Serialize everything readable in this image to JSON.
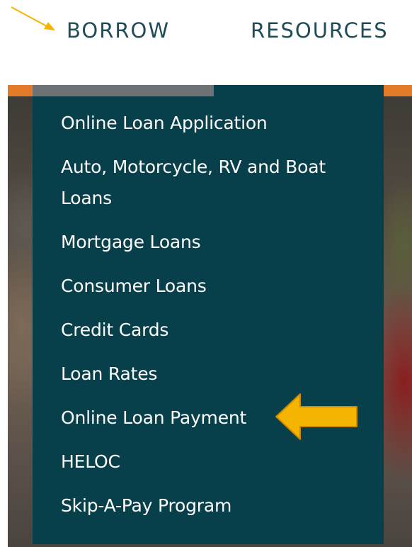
{
  "nav": {
    "borrow": "BORROW",
    "resources": "RESOURCES"
  },
  "dropdown": {
    "items": [
      {
        "label": "Online Loan Application"
      },
      {
        "label": "Auto, Motorcycle, RV and Boat Loans"
      },
      {
        "label": "Mortgage Loans"
      },
      {
        "label": "Consumer Loans"
      },
      {
        "label": "Credit Cards"
      },
      {
        "label": "Loan Rates"
      },
      {
        "label": "Online Loan Payment"
      },
      {
        "label": "HELOC"
      },
      {
        "label": "Skip-A-Pay Program"
      }
    ]
  },
  "annotations": {
    "pointer_icon": "arrow-pointer-icon",
    "callout_icon": "arrow-left-callout-icon",
    "callout_color": "#f5b400"
  },
  "colors": {
    "nav_text": "#1f4c56",
    "dropdown_bg": "#073f4b",
    "dropdown_topbar": "#6e7274",
    "accent_orange": "#e27a2a",
    "menu_text": "#ffffff"
  }
}
